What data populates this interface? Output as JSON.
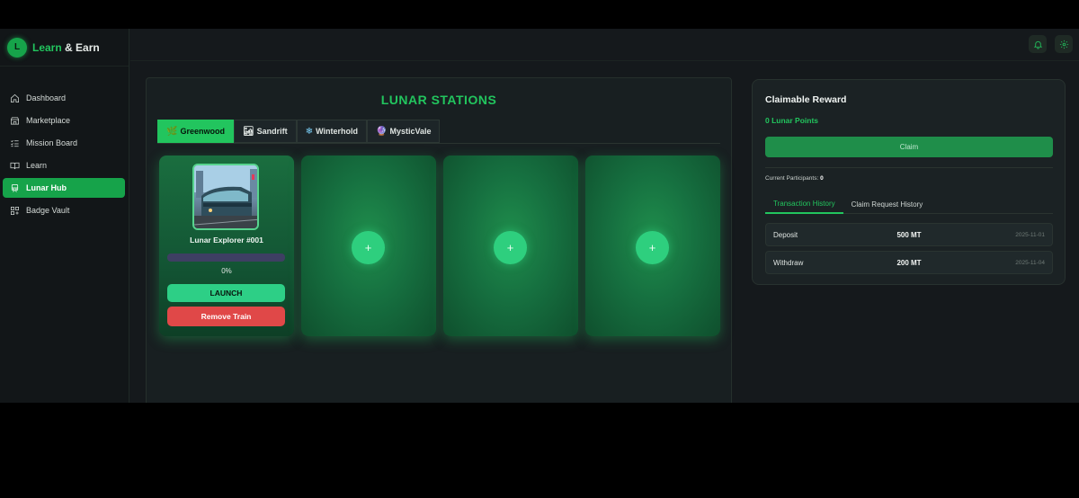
{
  "brand": {
    "logo_letter": "L",
    "name_accent": "Learn",
    "name_rest": " & Earn"
  },
  "sidebar": {
    "items": [
      {
        "label": "Dashboard",
        "icon": "home-icon"
      },
      {
        "label": "Marketplace",
        "icon": "store-icon"
      },
      {
        "label": "Mission Board",
        "icon": "list-check-icon"
      },
      {
        "label": "Learn",
        "icon": "book-icon"
      },
      {
        "label": "Lunar Hub",
        "icon": "train-icon",
        "active": true
      },
      {
        "label": "Badge Vault",
        "icon": "grid-plus-icon"
      }
    ]
  },
  "topbar": {
    "icons": [
      "bell-icon",
      "gear-icon"
    ]
  },
  "stations": {
    "title": "LUNAR STATIONS",
    "tabs": [
      {
        "label": "Greenwood",
        "icon": "🌿",
        "active": true
      },
      {
        "label": "Sandrift",
        "icon": "🏜",
        "active": false
      },
      {
        "label": "Winterhold",
        "icon": "❄",
        "active": false
      },
      {
        "label": "MysticVale",
        "icon": "🔮",
        "active": false
      }
    ],
    "train": {
      "name": "Lunar Explorer #001",
      "progress": 0,
      "progress_label": "0%",
      "launch_label": "LAUNCH",
      "remove_label": "Remove Train"
    },
    "add_label": "+"
  },
  "reward": {
    "title": "Claimable Reward",
    "points": "0 Lunar Points",
    "claim_label": "Claim",
    "participants_label": "Current Participants:",
    "participants_value": "0",
    "history_tabs": [
      "Transaction History",
      "Claim Request History"
    ],
    "history": [
      {
        "type": "Deposit",
        "amount": "500 MT",
        "date": "2025-11-01"
      },
      {
        "type": "Withdraw",
        "amount": "200 MT",
        "date": "2025-11-04"
      }
    ]
  },
  "colors": {
    "accent": "#22c55e",
    "danger": "#e04848",
    "background": "#15191c"
  }
}
